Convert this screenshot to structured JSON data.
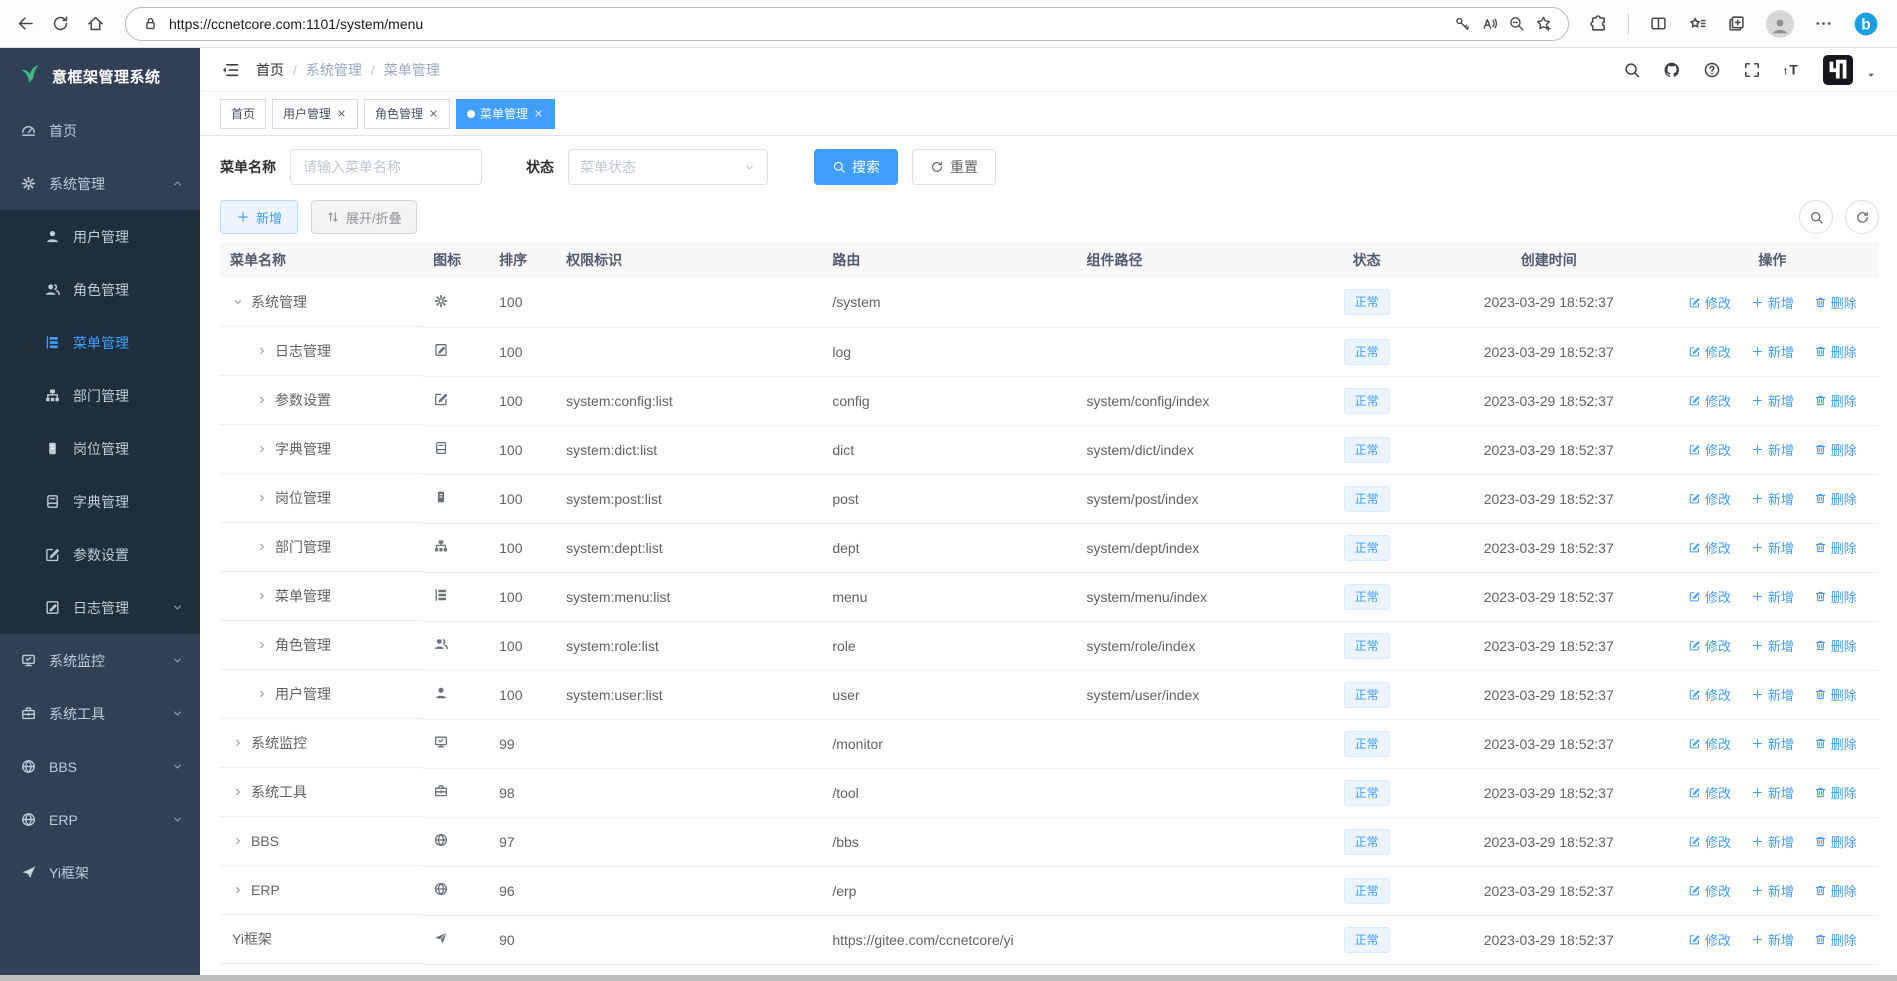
{
  "browser": {
    "url": "https://ccnetcore.com:1101/system/menu"
  },
  "sidebar": {
    "logo_text": "意框架管理系统",
    "items": [
      {
        "label": "首页",
        "icon": "dashboard",
        "level": 0
      },
      {
        "label": "系统管理",
        "icon": "gear",
        "level": 0,
        "chevron": "up"
      },
      {
        "label": "用户管理",
        "icon": "user",
        "level": 1
      },
      {
        "label": "角色管理",
        "icon": "users",
        "level": 1
      },
      {
        "label": "菜单管理",
        "icon": "menu-list",
        "level": 1,
        "active": true
      },
      {
        "label": "部门管理",
        "icon": "org-tree",
        "level": 1
      },
      {
        "label": "岗位管理",
        "icon": "badge",
        "level": 1
      },
      {
        "label": "字典管理",
        "icon": "dictionary",
        "level": 1
      },
      {
        "label": "参数设置",
        "icon": "edit-square",
        "level": 1
      },
      {
        "label": "日志管理",
        "icon": "log-edit",
        "level": 1,
        "chevron": "down"
      },
      {
        "label": "系统监控",
        "icon": "monitor",
        "level": 0,
        "chevron": "down"
      },
      {
        "label": "系统工具",
        "icon": "toolbox",
        "level": 0,
        "chevron": "down"
      },
      {
        "label": "BBS",
        "icon": "globe",
        "level": 0,
        "chevron": "down"
      },
      {
        "label": "ERP",
        "icon": "globe",
        "level": 0,
        "chevron": "down"
      },
      {
        "label": "Yi框架",
        "icon": "paper-plane",
        "level": 0
      }
    ]
  },
  "header": {
    "breadcrumb": [
      "首页",
      "系统管理",
      "菜单管理"
    ],
    "separator": "/"
  },
  "tabs": [
    {
      "label": "首页"
    },
    {
      "label": "用户管理",
      "closable": true
    },
    {
      "label": "角色管理",
      "closable": true
    },
    {
      "label": "菜单管理",
      "closable": true,
      "active": true
    }
  ],
  "filters": {
    "name_label": "菜单名称",
    "name_placeholder": "请输入菜单名称",
    "status_label": "状态",
    "status_placeholder": "菜单状态",
    "search_label": "搜索",
    "reset_label": "重置"
  },
  "toolbar": {
    "add_label": "新增",
    "expand_label": "展开/折叠"
  },
  "table": {
    "columns": [
      "菜单名称",
      "图标",
      "排序",
      "权限标识",
      "路由",
      "组件路径",
      "状态",
      "创建时间",
      "操作"
    ],
    "ops": {
      "edit": "修改",
      "add": "新增",
      "delete": "删除"
    },
    "rows": [
      {
        "name": "系统管理",
        "icon": "gear",
        "sort": "100",
        "perm": "",
        "route": "/system",
        "component": "",
        "status": "正常",
        "created": "2023-03-29 18:52:37",
        "level": 0,
        "expand": "down"
      },
      {
        "name": "日志管理",
        "icon": "log-edit",
        "sort": "100",
        "perm": "",
        "route": "log",
        "component": "",
        "status": "正常",
        "created": "2023-03-29 18:52:37",
        "level": 1,
        "expand": "right"
      },
      {
        "name": "参数设置",
        "icon": "edit-square",
        "sort": "100",
        "perm": "system:config:list",
        "route": "config",
        "component": "system/config/index",
        "status": "正常",
        "created": "2023-03-29 18:52:37",
        "level": 1,
        "expand": "right"
      },
      {
        "name": "字典管理",
        "icon": "dictionary",
        "sort": "100",
        "perm": "system:dict:list",
        "route": "dict",
        "component": "system/dict/index",
        "status": "正常",
        "created": "2023-03-29 18:52:37",
        "level": 1,
        "expand": "right"
      },
      {
        "name": "岗位管理",
        "icon": "badge",
        "sort": "100",
        "perm": "system:post:list",
        "route": "post",
        "component": "system/post/index",
        "status": "正常",
        "created": "2023-03-29 18:52:37",
        "level": 1,
        "expand": "right"
      },
      {
        "name": "部门管理",
        "icon": "org-tree",
        "sort": "100",
        "perm": "system:dept:list",
        "route": "dept",
        "component": "system/dept/index",
        "status": "正常",
        "created": "2023-03-29 18:52:37",
        "level": 1,
        "expand": "right"
      },
      {
        "name": "菜单管理",
        "icon": "menu-list",
        "sort": "100",
        "perm": "system:menu:list",
        "route": "menu",
        "component": "system/menu/index",
        "status": "正常",
        "created": "2023-03-29 18:52:37",
        "level": 1,
        "expand": "right"
      },
      {
        "name": "角色管理",
        "icon": "users",
        "sort": "100",
        "perm": "system:role:list",
        "route": "role",
        "component": "system/role/index",
        "status": "正常",
        "created": "2023-03-29 18:52:37",
        "level": 1,
        "expand": "right"
      },
      {
        "name": "用户管理",
        "icon": "user",
        "sort": "100",
        "perm": "system:user:list",
        "route": "user",
        "component": "system/user/index",
        "status": "正常",
        "created": "2023-03-29 18:52:37",
        "level": 1,
        "expand": "right"
      },
      {
        "name": "系统监控",
        "icon": "monitor",
        "sort": "99",
        "perm": "",
        "route": "/monitor",
        "component": "",
        "status": "正常",
        "created": "2023-03-29 18:52:37",
        "level": 0,
        "expand": "right"
      },
      {
        "name": "系统工具",
        "icon": "toolbox",
        "sort": "98",
        "perm": "",
        "route": "/tool",
        "component": "",
        "status": "正常",
        "created": "2023-03-29 18:52:37",
        "level": 0,
        "expand": "right"
      },
      {
        "name": "BBS",
        "icon": "globe",
        "sort": "97",
        "perm": "",
        "route": "/bbs",
        "component": "",
        "status": "正常",
        "created": "2023-03-29 18:52:37",
        "level": 0,
        "expand": "right"
      },
      {
        "name": "ERP",
        "icon": "globe",
        "sort": "96",
        "perm": "",
        "route": "/erp",
        "component": "",
        "status": "正常",
        "created": "2023-03-29 18:52:37",
        "level": 0,
        "expand": "right"
      },
      {
        "name": "Yi框架",
        "icon": "paper-plane",
        "sort": "90",
        "perm": "",
        "route": "https://gitee.com/ccnetcore/yi",
        "component": "",
        "status": "正常",
        "created": "2023-03-29 18:52:37",
        "level": 0,
        "expand": ""
      }
    ]
  },
  "colors": {
    "accent": "#409eff",
    "sidebar_bg": "#304156",
    "submenu_bg": "#1f2d3d",
    "logo_green": "#42b983",
    "status_tag_bg": "#ecf5ff",
    "status_tag_text": "#409eff"
  }
}
